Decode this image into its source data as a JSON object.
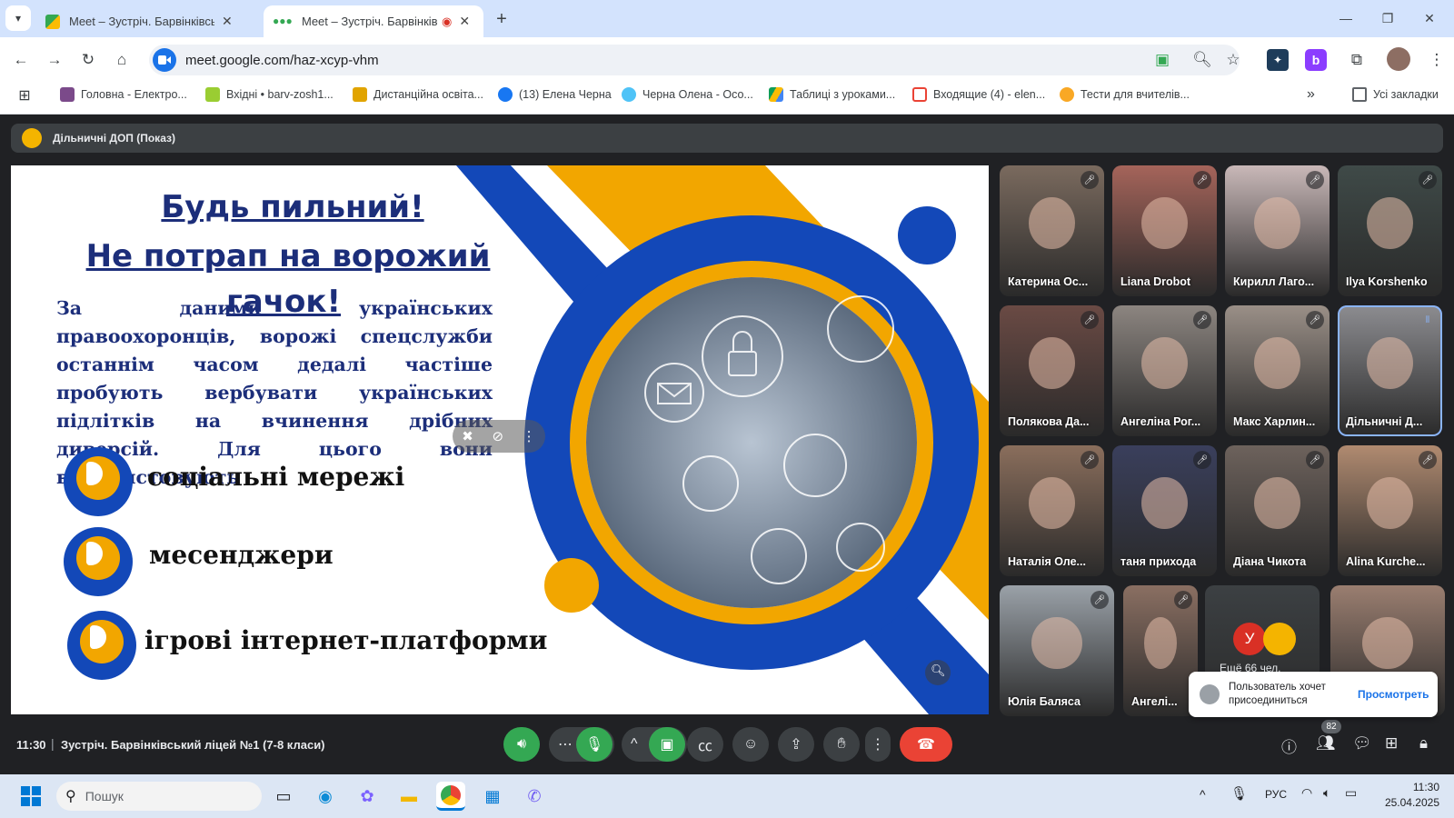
{
  "browser": {
    "tabs": [
      {
        "title": "Meet – Зустріч. Барвінківський",
        "active": false
      },
      {
        "title": "Meet – Зустріч. Барвінківс",
        "active": true
      }
    ],
    "new_tab": "+",
    "window_controls": [
      "—",
      "❐",
      "✕"
    ],
    "url": "meet.google.com/haz-xcyp-vhm",
    "bookmarks": [
      "Головна - Електро...",
      "Вхідні • barv-zosh1...",
      "Дистанційна освіта...",
      "(13) Елена Черна",
      "Черна Олена - Осо...",
      "Таблиці з уроками...",
      "Входящие (4) - elen...",
      "Тести для вчителів..."
    ],
    "bookmarks_more": "»",
    "all_bookmarks": "Усі закладки"
  },
  "meet": {
    "presenter_label": "Дільничні ДОП (Показ)",
    "slide": {
      "title1": "Будь пильний!",
      "title2": "Не потрап на ворожий",
      "title3": "гачок!",
      "body": "За даними українських правоохоронців, ворожі спецслужби останнім часом дедалі частіше пробують вербувати українських підлітків на вчинення дрібних диверсій. Для цього вони використовують",
      "bullets": [
        "соціальні мережі",
        "месенджери",
        "ігрові інтернет-платформи"
      ]
    },
    "participants": [
      {
        "name": "Катерина Ос...",
        "color": "#7a6a5e"
      },
      {
        "name": "Liana Drobot",
        "color": "#a5645a"
      },
      {
        "name": "Кирилл Лаго...",
        "color": "#c9b8b8"
      },
      {
        "name": "Ilya Korshenko",
        "color": "#3f4a48"
      },
      {
        "name": "Полякова Да...",
        "color": "#6a4a44"
      },
      {
        "name": "Ангеліна Рог...",
        "color": "#8c8580"
      },
      {
        "name": "Макс Харлин...",
        "color": "#9a8f87"
      },
      {
        "name": "Дільничні Д...",
        "color": "#8c8c90"
      },
      {
        "name": "Наталія Оле...",
        "color": "#8a6e5c"
      },
      {
        "name": "таня прихода",
        "color": "#3a3f5c"
      },
      {
        "name": "Діана Чикота",
        "color": "#6d625c"
      },
      {
        "name": "Alina Kurche...",
        "color": "#b08a70"
      },
      {
        "name": "Юлія Баляса",
        "color": "#9aa1a8"
      },
      {
        "name": "Ангелі...",
        "color": "#8a6f62"
      },
      {
        "name": "",
        "color": "#3c4043"
      },
      {
        "name": "",
        "color": "#9a7e70"
      }
    ],
    "others_avatar_letter": "У",
    "others_label": "Ещё 66 чел.",
    "join_request": {
      "text": "Пользователь хочет присоединиться",
      "action": "Просмотреть"
    },
    "time": "11:30",
    "meeting_title": "Зустріч. Барвінківський ліцей №1 (7-8 класи)",
    "participant_count": "82"
  },
  "taskbar": {
    "search_placeholder": "Пошук",
    "lang": "РУС",
    "time": "11:30",
    "date": "25.04.2025"
  },
  "colors": {
    "meet_bg": "#202124",
    "accent_green": "#34a853",
    "end_call": "#ea4335",
    "slide_blue": "#1c2e7a",
    "slide_orange": "#f2a600"
  }
}
